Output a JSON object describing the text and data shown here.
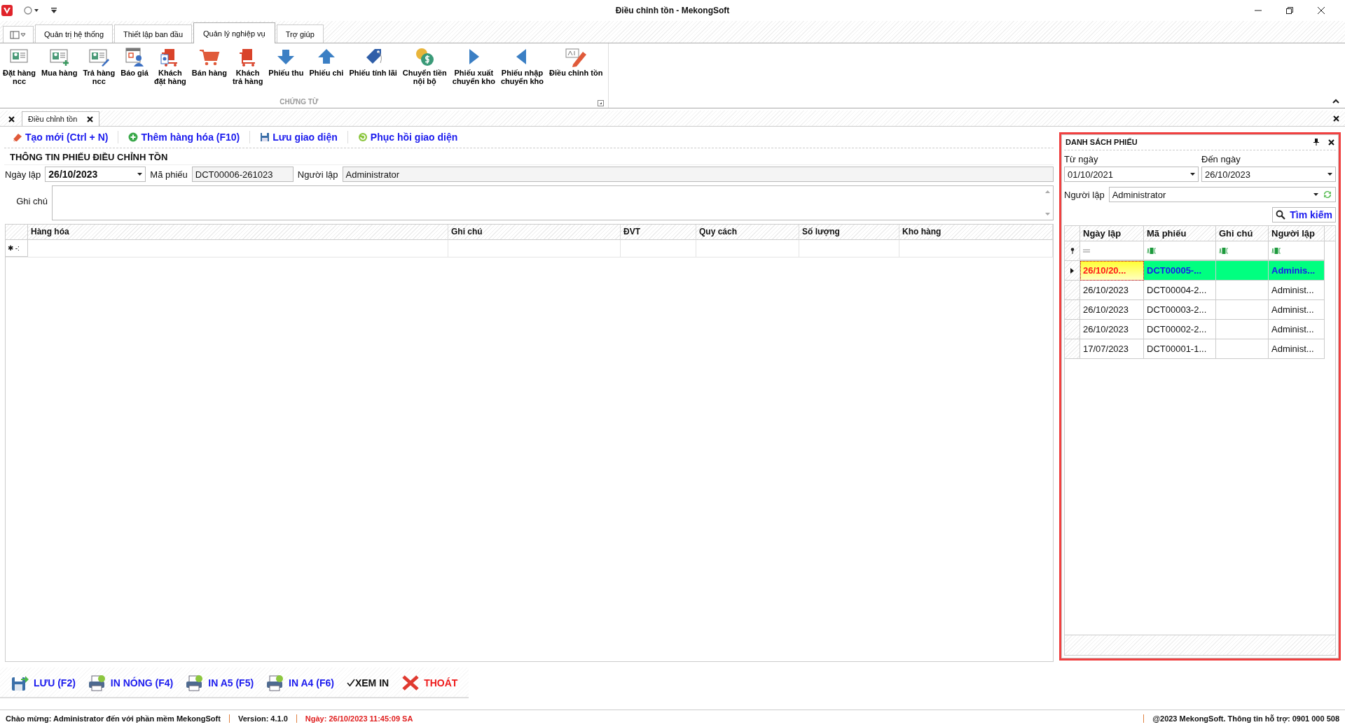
{
  "window": {
    "title": "Điều chỉnh tồn - MekongSoft"
  },
  "ribbon_tabs": [
    {
      "label": "Quản trị hệ thống",
      "selected": false
    },
    {
      "label": "Thiết lập ban đầu",
      "selected": false
    },
    {
      "label": "Quản lý nghiệp vụ",
      "selected": true
    },
    {
      "label": "Trợ giúp",
      "selected": false
    }
  ],
  "ribbon": {
    "group_label": "CHỨNG TỪ",
    "buttons": [
      {
        "label": "Đặt hàng\nncc",
        "kind": "card"
      },
      {
        "label": "Mua hàng",
        "kind": "card-plus"
      },
      {
        "label": "Trả hàng\nncc",
        "kind": "card-pen"
      },
      {
        "label": "Báo giá",
        "kind": "calendar-person"
      },
      {
        "label": "Khách\nđặt hàng",
        "kind": "doc-cart"
      },
      {
        "label": "Bán hàng",
        "kind": "cart"
      },
      {
        "label": "Khách\ntrả hàng",
        "kind": "box-cart"
      },
      {
        "label": "Phiếu thu",
        "kind": "arrow-down"
      },
      {
        "label": "Phiếu chi",
        "kind": "arrow-up"
      },
      {
        "label": "Phiếu tính lãi",
        "kind": "tag"
      },
      {
        "label": "Chuyển tiền\nnội bộ",
        "kind": "coins"
      },
      {
        "label": "Phiếu xuất\nchuyển kho",
        "kind": "arrow-right"
      },
      {
        "label": "Phiếu nhập\nchuyển kho",
        "kind": "arrow-left"
      },
      {
        "label": "Điều chỉnh tồn",
        "kind": "edit"
      }
    ]
  },
  "document_tab": {
    "label": "Điều chỉnh tồn"
  },
  "toolbar": [
    {
      "label": "Tạo mới (Ctrl + N)",
      "kind": "eraser"
    },
    {
      "label": "Thêm hàng hóa (F10)",
      "kind": "plus"
    },
    {
      "label": "Lưu giao diện",
      "kind": "save"
    },
    {
      "label": "Phục hồi giao diện",
      "kind": "restore"
    }
  ],
  "form": {
    "title": "THÔNG TIN PHIẾU ĐIỀU CHỈNH TỒN",
    "date_label": "Ngày lập",
    "date_value": "26/10/2023",
    "code_label": "Mã phiếu",
    "code_value": "DCT00006-261023",
    "creator_label": "Người lập",
    "creator_value": "Administrator",
    "note_label": "Ghi chú"
  },
  "items_table": {
    "columns": [
      "Hàng hóa",
      "Ghi chú",
      "ĐVT",
      "Quy cách",
      "Số lượng",
      "Kho hàng"
    ],
    "new_row_marker": "✱ -:"
  },
  "list_panel": {
    "title": "DANH SÁCH PHIẾU",
    "from_label": "Từ ngày",
    "from_value": "01/10/2021",
    "to_label": "Đến ngày",
    "to_value": "26/10/2023",
    "creator_label": "Người lập",
    "creator_value": "Administrator",
    "search_button": "Tìm kiếm",
    "columns": [
      "Ngày lập",
      "Mã phiếu",
      "Ghi chú",
      "Người lập"
    ],
    "rows": [
      {
        "date": "26/10/20...",
        "code": "DCT00005-...",
        "note": "",
        "creator": "Adminis...",
        "selected": true
      },
      {
        "date": "26/10/2023",
        "code": "DCT00004-2...",
        "note": "",
        "creator": "Administ...",
        "selected": false
      },
      {
        "date": "26/10/2023",
        "code": "DCT00003-2...",
        "note": "",
        "creator": "Administ...",
        "selected": false
      },
      {
        "date": "26/10/2023",
        "code": "DCT00002-2...",
        "note": "",
        "creator": "Administ...",
        "selected": false
      },
      {
        "date": "17/07/2023",
        "code": "DCT00001-1...",
        "note": "",
        "creator": "Administ...",
        "selected": false
      }
    ]
  },
  "bottom_bar": [
    {
      "label": "LƯU (F2)",
      "kind": "save"
    },
    {
      "label": "IN NÓNG (F4)",
      "kind": "print"
    },
    {
      "label": "IN A5 (F5)",
      "kind": "print"
    },
    {
      "label": "IN A4 (F6)",
      "kind": "print"
    },
    {
      "label": "XEM IN",
      "kind": "checkbox",
      "checked": true
    },
    {
      "label": "THOÁT",
      "kind": "exit"
    }
  ],
  "status_bar": {
    "welcome": "Chào mừng: Administrator đến với phần mềm MekongSoft",
    "version": "Version: 4.1.0",
    "date": "Ngày: 26/10/2023 11:45:09 SA",
    "copyright": "@2023 MekongSoft. Thông tin hỗ trợ: 0901 000 508"
  }
}
